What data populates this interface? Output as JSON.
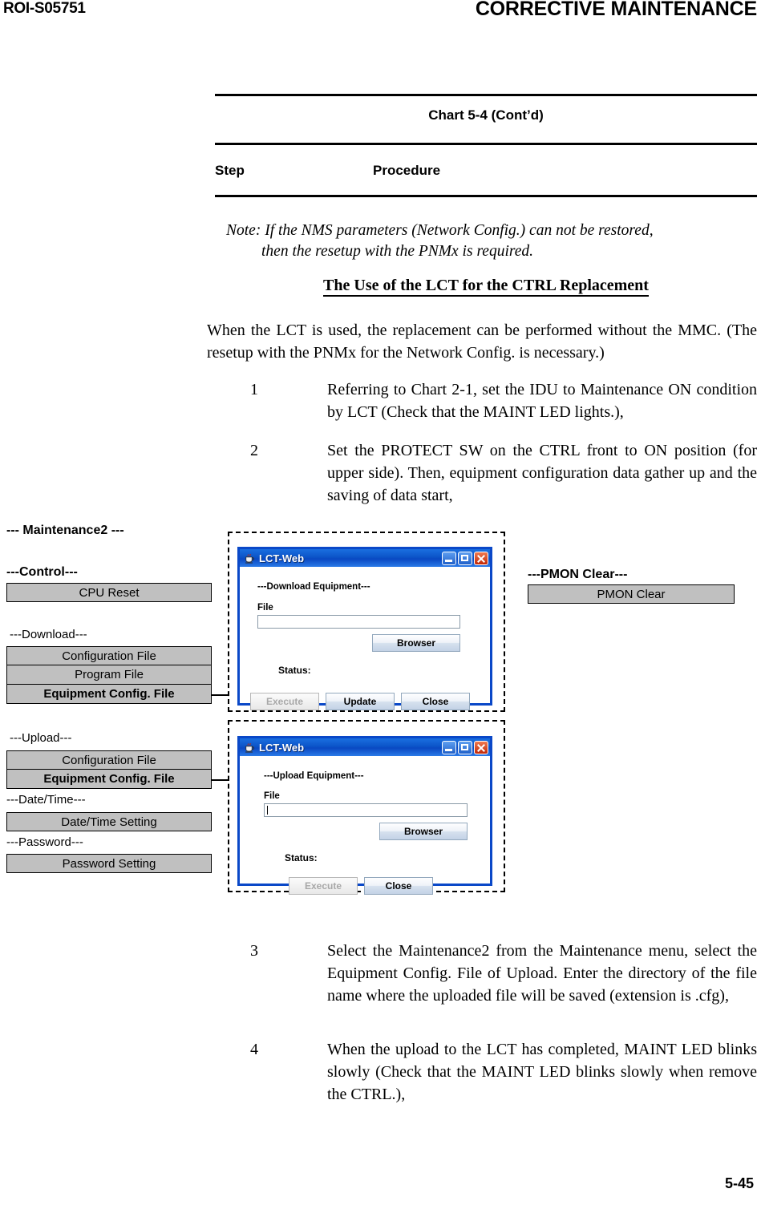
{
  "header": {
    "doc_id": "ROI-S05751",
    "section_title": "CORRECTIVE MAINTENANCE"
  },
  "chart": {
    "title": "Chart 5-4  (Cont’d)",
    "col_step": "Step",
    "col_procedure": "Procedure"
  },
  "note": {
    "label": "Note:",
    "line1": "Note: If the NMS parameters (Network Config.) can not be restored,",
    "line2": "then the resetup with the PNMx is required."
  },
  "section_heading": "The Use of the LCT for the CTRL Replacement",
  "intro_paragraph": "When the LCT is used, the replacement can be performed without the MMC. (The resetup with the PNMx for the Network Config. is necessary.)",
  "steps": [
    {
      "number": "1",
      "text": "Referring to Chart 2-1, set the IDU to Maintenance ON condition by LCT (Check that the MAINT LED lights.),"
    },
    {
      "number": "2",
      "text": "Set the PROTECT SW on the CTRL front to ON position (for upper side).  Then, equipment configuration data gather up and the saving of data start,"
    },
    {
      "number": "3",
      "text": "Select the Maintenance2 from the Maintenance menu, select the Equipment Config. File of Upload.  Enter the directory of the file name where the uploaded file will be saved (extension is .cfg),"
    },
    {
      "number": "4",
      "text": "When the upload to the LCT has completed, MAINT LED blinks slowly (Check that the MAINT LED blinks slowly when remove the CTRL.),"
    }
  ],
  "menu": {
    "title": "--- Maintenance2 ---",
    "groups": [
      {
        "label": "---Control---",
        "items": [
          {
            "label": "CPU Reset",
            "bold": false
          }
        ]
      },
      {
        "label": "---Download---",
        "items": [
          {
            "label": "Configuration File",
            "bold": false
          },
          {
            "label": "Program File",
            "bold": false
          },
          {
            "label": "Equipment Config. File",
            "bold": true
          }
        ]
      },
      {
        "label": "---Upload---",
        "items": [
          {
            "label": "Configuration File",
            "bold": false
          },
          {
            "label": "Equipment Config. File",
            "bold": true
          }
        ]
      },
      {
        "label": "---Date/Time---",
        "items": [
          {
            "label": "Date/Time Setting",
            "bold": false
          }
        ]
      },
      {
        "label": "---Password---",
        "items": [
          {
            "label": "Password Setting",
            "bold": false
          }
        ]
      }
    ]
  },
  "pmon": {
    "label": "---PMON Clear---",
    "button": "PMON Clear"
  },
  "download_dialog": {
    "window_title": "LCT-Web",
    "panel_caption": "---Download Equipment---",
    "file_label": "File",
    "file_value": "",
    "browser_button": "Browser",
    "status_label": "Status:",
    "status_value": "",
    "buttons": [
      {
        "label": "Execute",
        "enabled": false
      },
      {
        "label": "Update",
        "enabled": true
      },
      {
        "label": "Close",
        "enabled": true
      }
    ]
  },
  "upload_dialog": {
    "window_title": "LCT-Web",
    "panel_caption": "---Upload Equipment---",
    "file_label": "File",
    "file_value": "",
    "browser_button": "Browser",
    "status_label": "Status:",
    "status_value": "",
    "buttons": [
      {
        "label": "Execute",
        "enabled": false
      },
      {
        "label": "Close",
        "enabled": true
      }
    ]
  },
  "footer": {
    "page_number": "5-45"
  },
  "colors": {
    "title_bar_blue": "#0c54c8",
    "window_border": "#0a48c8",
    "menu_button_gray": "#c0c0c0",
    "close_button_red": "#c02808"
  }
}
